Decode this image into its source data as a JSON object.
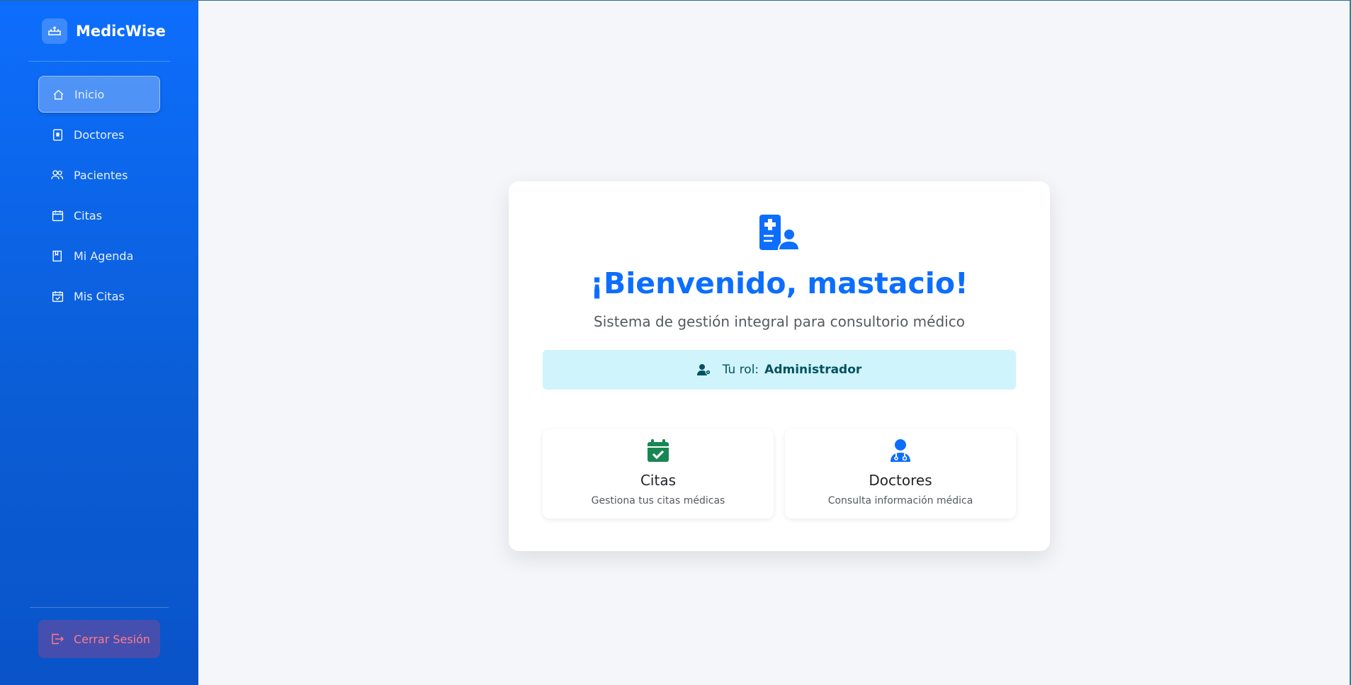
{
  "brand": {
    "name": "MedicWise"
  },
  "sidebar": {
    "items": [
      {
        "label": "Inicio",
        "icon": "home-icon",
        "active": true
      },
      {
        "label": "Doctores",
        "icon": "doctor-badge-icon"
      },
      {
        "label": "Pacientes",
        "icon": "users-icon"
      },
      {
        "label": "Citas",
        "icon": "calendar-icon"
      },
      {
        "label": "Mi Agenda",
        "icon": "agenda-icon"
      },
      {
        "label": "Mis Citas",
        "icon": "calendar-check-icon"
      }
    ],
    "logout_label": "Cerrar Sesión"
  },
  "welcome": {
    "title": "¡Bienvenido, mastacio!",
    "subtitle": "Sistema de gestión integral para consultorio médico",
    "role_prefix": "Tu rol:",
    "role_value": "Administrador"
  },
  "tiles": [
    {
      "title": "Citas",
      "desc": "Gestiona tus citas médicas",
      "icon": "calendar-check-icon",
      "color": "#198754"
    },
    {
      "title": "Doctores",
      "desc": "Consulta información médica",
      "icon": "user-doctor-icon",
      "color": "#0d6efd"
    }
  ],
  "colors": {
    "accent": "#0d6efd",
    "info_bg": "#cff4fc",
    "info_text": "#055160",
    "danger": "#ff7b8b"
  }
}
